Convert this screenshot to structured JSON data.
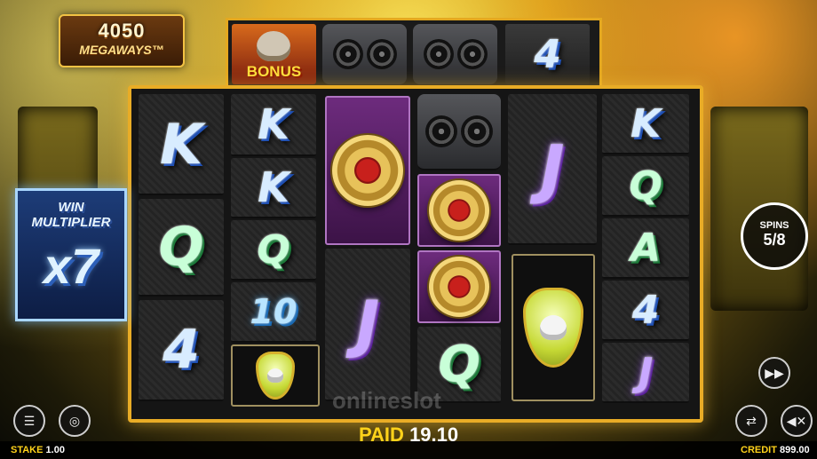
{
  "logo": {
    "number": "4050",
    "word": "MEGAWAYS™"
  },
  "top_reel": [
    {
      "symbol": "bonus-skull",
      "label": "BONUS"
    },
    {
      "symbol": "speaker"
    },
    {
      "symbol": "speaker"
    },
    {
      "symbol": "4"
    }
  ],
  "reels": [
    [
      {
        "s": "K"
      },
      {
        "s": "Q"
      },
      {
        "s": "4"
      }
    ],
    [
      {
        "s": "K"
      },
      {
        "s": "K"
      },
      {
        "s": "Q"
      },
      {
        "s": "10"
      },
      {
        "s": "guitar-pick"
      }
    ],
    [
      {
        "s": "record"
      },
      {
        "s": "J"
      }
    ],
    [
      {
        "s": "speaker"
      },
      {
        "s": "record"
      },
      {
        "s": "record"
      },
      {
        "s": "Q"
      }
    ],
    [
      {
        "s": "J"
      },
      {
        "s": "guitar-pick"
      }
    ],
    [
      {
        "s": "K"
      },
      {
        "s": "Q"
      },
      {
        "s": "A"
      },
      {
        "s": "4"
      },
      {
        "s": "J"
      }
    ]
  ],
  "win_multiplier": {
    "line1": "WIN",
    "line2": "MULTIPLIER",
    "value": "x7"
  },
  "spins": {
    "label": "SPINS",
    "value": "5/8"
  },
  "paid": {
    "label": "PAID",
    "value": "19.10"
  },
  "stake": {
    "label": "STAKE",
    "value": "1.00"
  },
  "credit": {
    "label": "CREDIT",
    "value": "899.00"
  },
  "watermark": "onlineslot",
  "icons": {
    "menu": "menu-icon",
    "coins": "coins-icon",
    "autoplay": "autoplay-icon",
    "sound": "sound-off-icon",
    "turbo": "fast-forward-icon"
  }
}
